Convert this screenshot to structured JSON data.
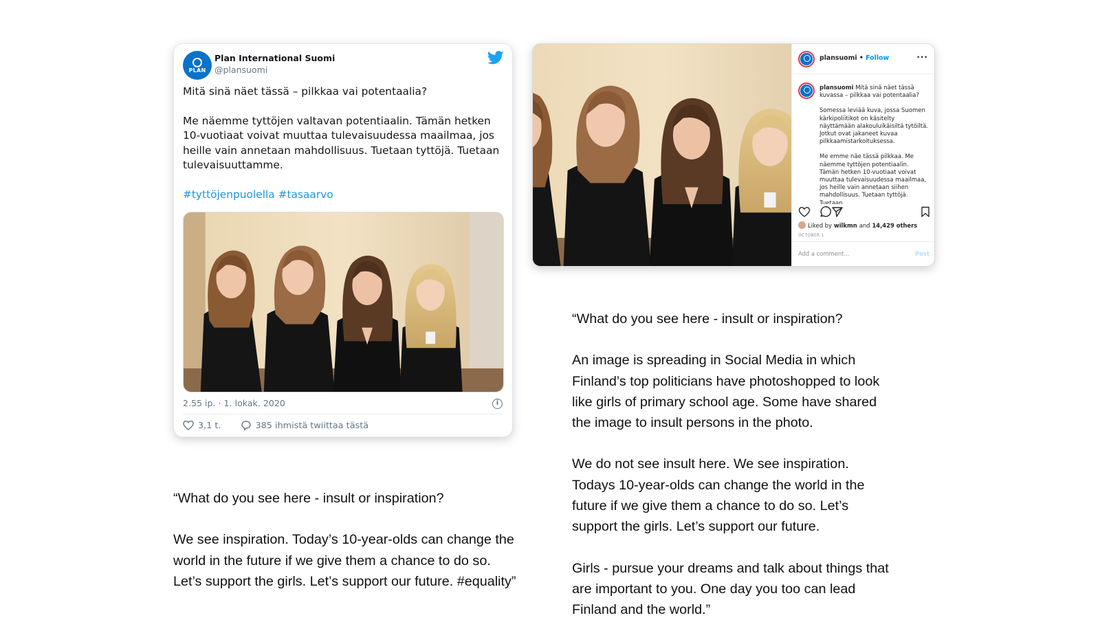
{
  "tweet": {
    "account_name": "Plan International Suomi",
    "handle": "@plansuomi",
    "avatar_text": "PLAN",
    "paragraphs": [
      "Mitä sinä näet tässä – pilkkaa vai potentaalia?",
      "Me näemme tyttöjen valtavan potentiaalin. Tämän hetken 10-vuotiaat voivat muuttaa tulevaisuudessa maailmaa, jos heille vain annetaan mahdollisuus. Tuetaan tyttöjä. Tuetaan tulevaisuuttamme."
    ],
    "hashtags": "#tyttöjenpuolella #tasaarvo",
    "timestamp": "2.55 ip. · 1. lokak. 2020",
    "likes": "3,1 t.",
    "replies": "385 ihmistä twiittaa tästä"
  },
  "instagram": {
    "username": "plansuomi",
    "separator": " • ",
    "follow_label": "Follow",
    "caption_user": "plansuomi",
    "caption_lines": [
      "Mitä sinä näet tässä kuvassa – pilkkaa vai potentaalia?",
      "Somessa leviää kuva, jossa Suomen kärkipoliitikot on käsitelty näyttämään alakouluikäisiltä tytöiltä. Jotkut ovat jakaneet kuvaa pilkkaamistarkoituksessa.",
      "Me emme näe tässä pilkkaa. Me näemme tyttöjen potentiaalin. Tämän hetken 10-vuotiaat voivat muuttaa tulevaisuudessa maailmaa, jos heille vain annetaan siihen mahdollisuus. Tuetaan tyttöjä. Tuetaan"
    ],
    "liked_by_prefix": "Liked by",
    "liked_by_user": "wilkmn",
    "liked_by_and": "and",
    "liked_by_others": "14,429 others",
    "date": "OCTOBER 1",
    "comment_placeholder": "Add a comment...",
    "post_label": "Post"
  },
  "left_copy": [
    "“What do you see here - insult or inspiration?",
    "We see inspiration. Today’s 10-year-olds can change the world in the future if we give them a chance to do so. Let’s support the girls. Let’s support our future. #equality”"
  ],
  "right_copy": [
    "“What do you see here - insult or inspiration?",
    "An image is spreading in Social Media in which Finland’s top politicians have photoshopped to look like girls of primary school age. Some have shared the image to insult persons in the photo.",
    "We do not see insult here. We see inspiration. Todays 10-year-olds can change the world in the future if we give them a chance to do so. Let’s support the girls. Let’s support our future.",
    "Girls - pursue your dreams and talk about things that are important to you. One day you too can lead Finland and the world.”"
  ],
  "colors": {
    "twitter_blue": "#1da1f2",
    "link_blue": "#1b95e0",
    "plan_blue": "#0a72c9",
    "instagram_follow": "#0095f6"
  }
}
